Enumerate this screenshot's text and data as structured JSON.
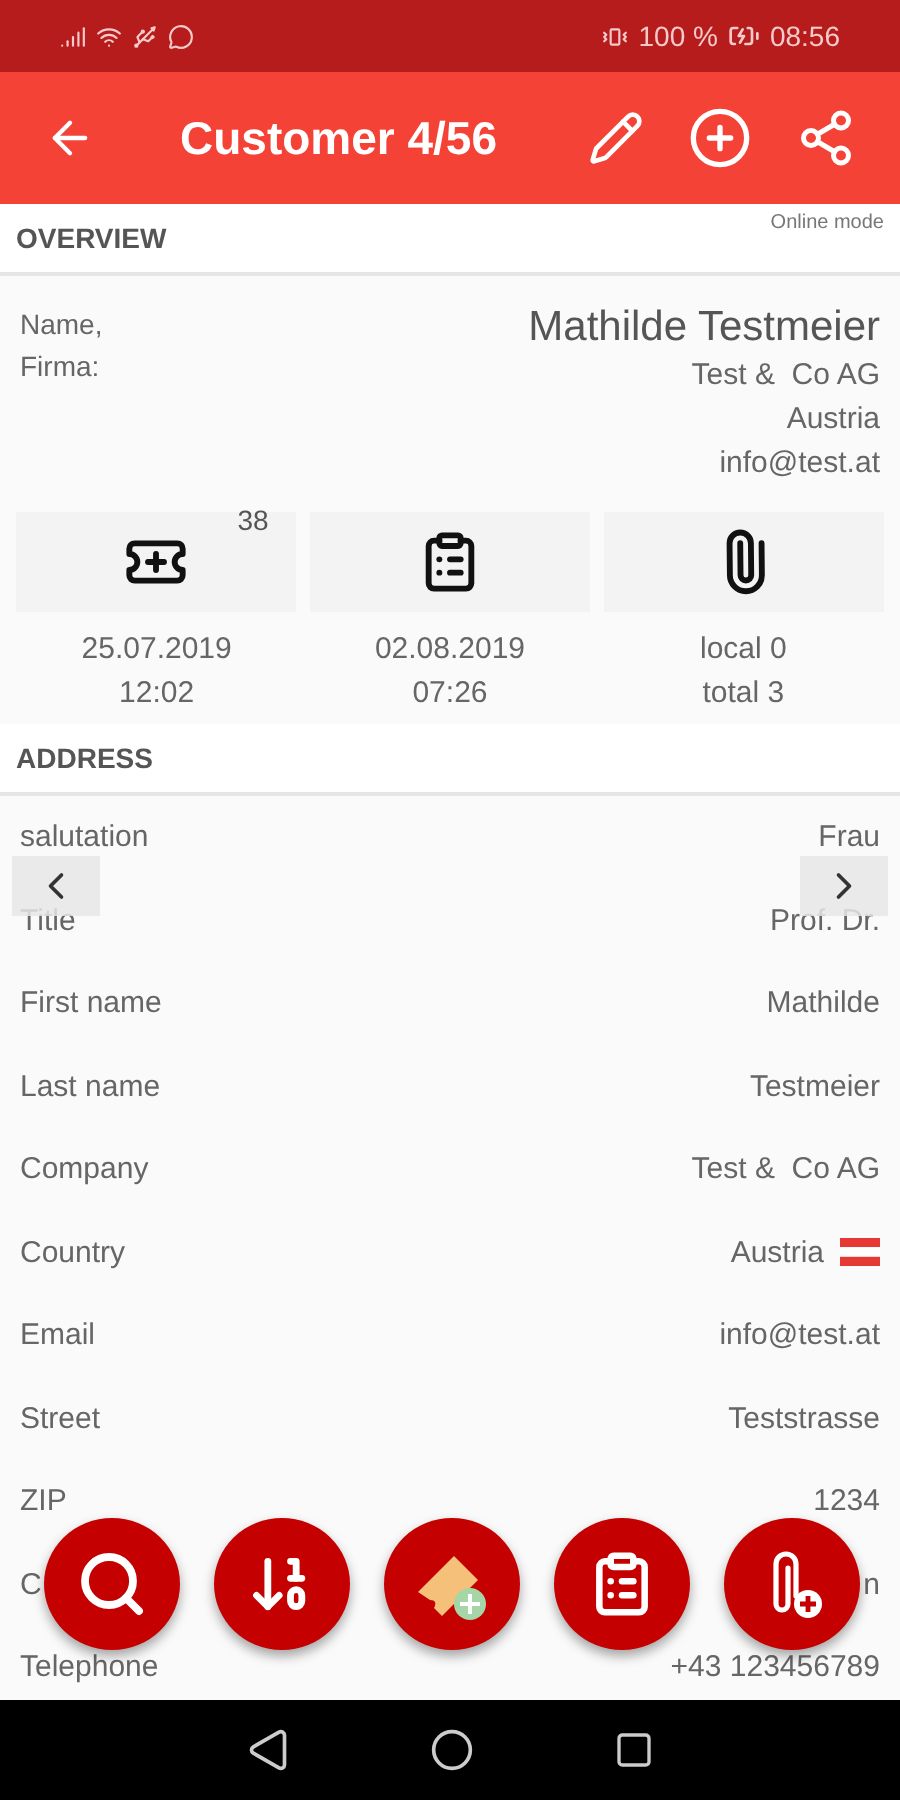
{
  "status_bar": {
    "battery": "100 %",
    "time": "08:56"
  },
  "toolbar": {
    "title": "Customer 4/56"
  },
  "overview": {
    "heading": "OVERVIEW",
    "mode": "Online mode",
    "name_label": "Name,\nFirma:",
    "name": "Mathilde Testmeier",
    "details": [
      "Test &  Co AG",
      "Austria",
      "info@test.at"
    ],
    "stats": [
      {
        "kind": "ticket",
        "badge": "38",
        "lines": [
          "25.07.2019",
          "12:02"
        ]
      },
      {
        "kind": "clipboard",
        "lines": [
          "02.08.2019",
          "07:26"
        ]
      },
      {
        "kind": "attachment",
        "lines": [
          "local 0",
          "total 3"
        ]
      }
    ]
  },
  "address": {
    "heading": "ADDRESS",
    "rows": [
      {
        "label": "salutation",
        "value": "Frau"
      },
      {
        "label": "Title",
        "value": "Prof. Dr."
      },
      {
        "label": "First name",
        "value": "Mathilde"
      },
      {
        "label": "Last name",
        "value": "Testmeier"
      },
      {
        "label": "Company",
        "value": "Test &  Co AG"
      },
      {
        "label": "Country",
        "value": "Austria",
        "flag": true
      },
      {
        "label": "Email",
        "value": "info@test.at"
      },
      {
        "label": "Street",
        "value": "Teststrasse"
      },
      {
        "label": "ZIP",
        "value": "1234"
      },
      {
        "label": "C",
        "value": "n"
      },
      {
        "label": "Telephone",
        "value": "+43 123456789"
      }
    ]
  },
  "fabs": [
    {
      "kind": "search"
    },
    {
      "kind": "sort"
    },
    {
      "kind": "ticket"
    },
    {
      "kind": "clipboard"
    },
    {
      "kind": "attachment"
    }
  ]
}
